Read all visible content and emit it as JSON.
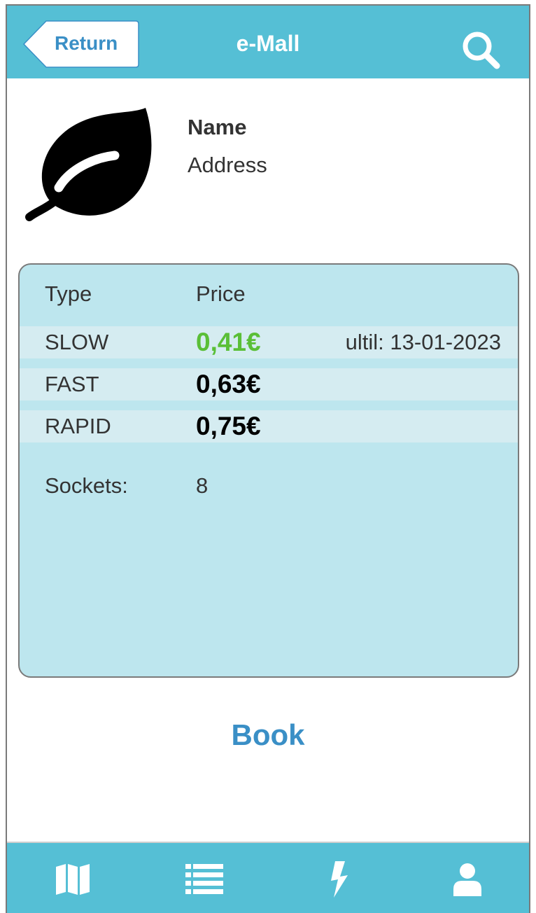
{
  "header": {
    "return_label": "Return",
    "title": "e-Mall",
    "search_icon": "search-icon"
  },
  "station": {
    "logo_icon": "leaf-icon",
    "name": "Name",
    "address": "Address"
  },
  "pricing": {
    "column_headers": [
      "Type",
      "Price"
    ],
    "rows": [
      {
        "type": "SLOW",
        "price": "0,41€",
        "promo": true,
        "until": "ultil: 13-01-2023"
      },
      {
        "type": "FAST",
        "price": "0,63€",
        "promo": false,
        "until": ""
      },
      {
        "type": "RAPID",
        "price": "0,75€",
        "promo": false,
        "until": ""
      }
    ],
    "sockets_label": "Sockets:",
    "sockets_value": "8"
  },
  "book_label": "Book",
  "tabbar": {
    "items": [
      {
        "icon": "map-icon"
      },
      {
        "icon": "list-icon"
      },
      {
        "icon": "lightning-icon"
      },
      {
        "icon": "user-icon"
      }
    ]
  },
  "colors": {
    "accent": "#55bfd5",
    "link": "#3a8fc6",
    "promo_price": "#5abf37",
    "card_bg": "#bde6ee",
    "row_bg": "#d5ecf1"
  }
}
